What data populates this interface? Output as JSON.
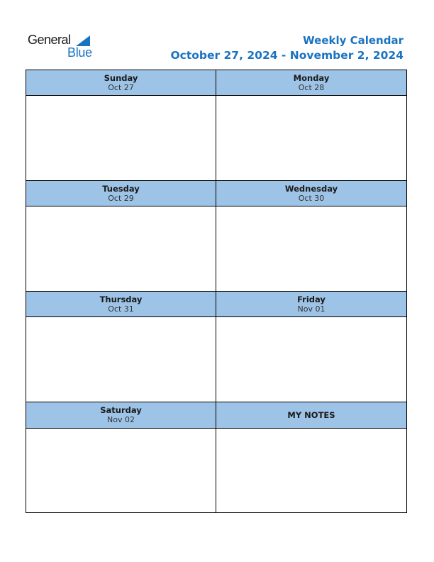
{
  "logo": {
    "word1": "General",
    "word2": "Blue"
  },
  "header": {
    "title": "Weekly Calendar",
    "date_range": "October 27, 2024 - November 2, 2024"
  },
  "colors": {
    "accent": "#1a73c0",
    "header_fill": "#9dc3e6"
  },
  "days": [
    {
      "day": "Sunday",
      "date": "Oct 27"
    },
    {
      "day": "Monday",
      "date": "Oct 28"
    },
    {
      "day": "Tuesday",
      "date": "Oct 29"
    },
    {
      "day": "Wednesday",
      "date": "Oct 30"
    },
    {
      "day": "Thursday",
      "date": "Oct 31"
    },
    {
      "day": "Friday",
      "date": "Nov 01"
    },
    {
      "day": "Saturday",
      "date": "Nov 02"
    }
  ],
  "notes": {
    "label": "MY NOTES"
  }
}
